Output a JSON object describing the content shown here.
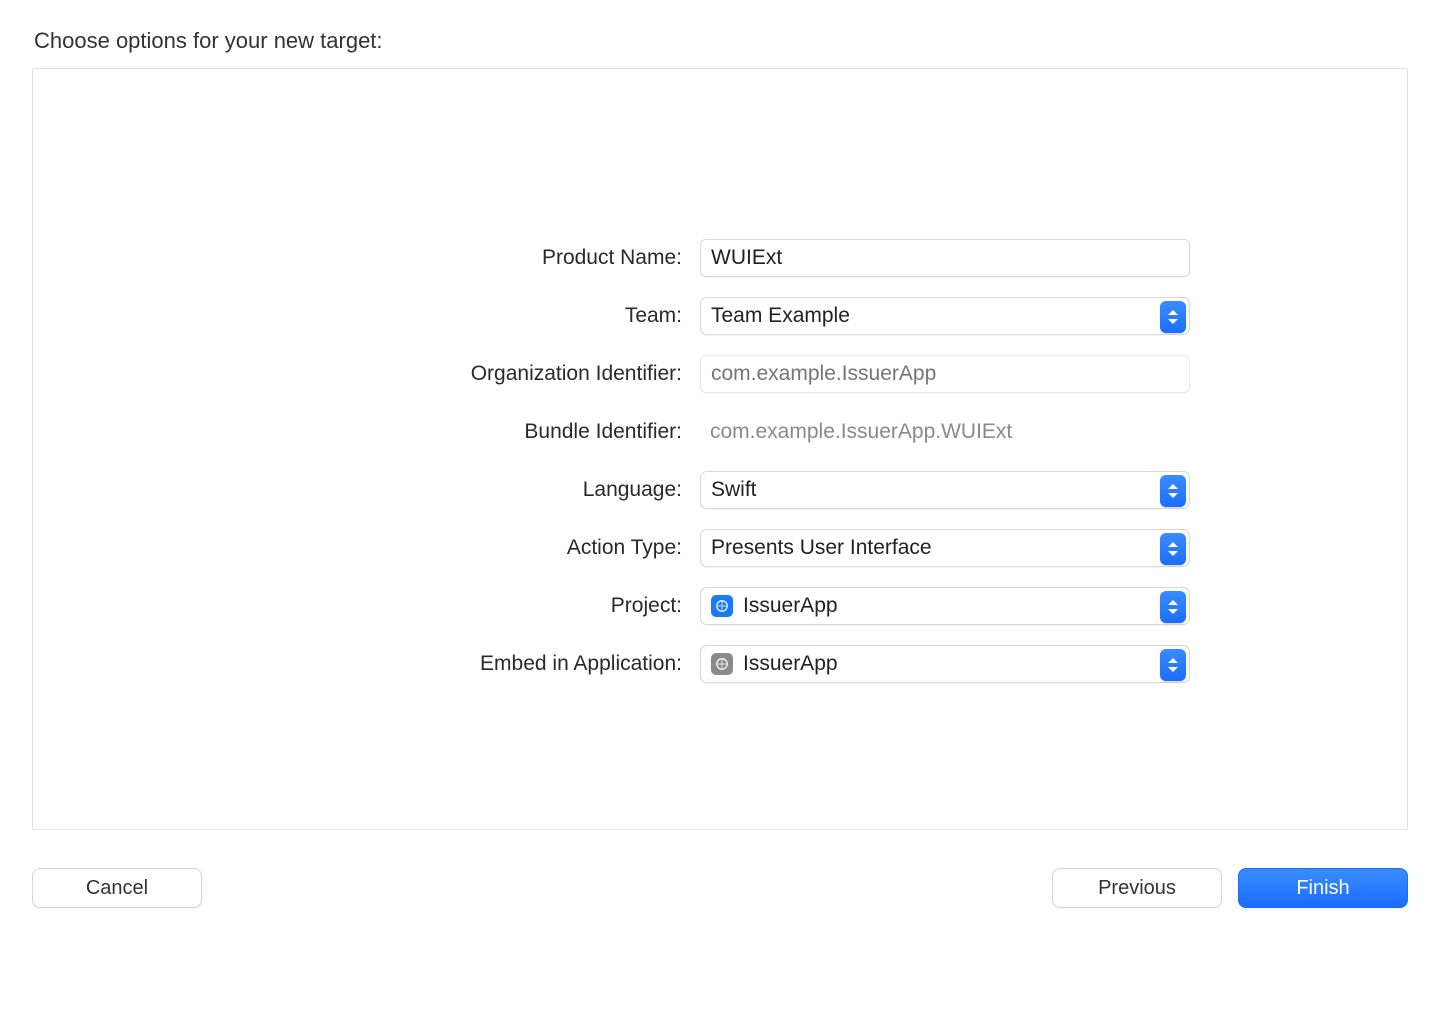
{
  "title": "Choose options for your new target:",
  "form": {
    "product_name": {
      "label": "Product Name:",
      "value": "WUIExt"
    },
    "team": {
      "label": "Team:",
      "value": "Team Example"
    },
    "org_identifier": {
      "label": "Organization Identifier:",
      "placeholder": "com.example.IssuerApp"
    },
    "bundle_identifier": {
      "label": "Bundle Identifier:",
      "value": "com.example.IssuerApp.WUIExt"
    },
    "language": {
      "label": "Language:",
      "value": "Swift"
    },
    "action_type": {
      "label": "Action Type:",
      "value": "Presents User Interface"
    },
    "project": {
      "label": "Project:",
      "value": "IssuerApp",
      "icon": "xcode-project-icon",
      "icon_color": "blue"
    },
    "embed": {
      "label": "Embed in Application:",
      "value": "IssuerApp",
      "icon": "app-icon",
      "icon_color": "gray"
    }
  },
  "buttons": {
    "cancel": "Cancel",
    "previous": "Previous",
    "finish": "Finish"
  }
}
